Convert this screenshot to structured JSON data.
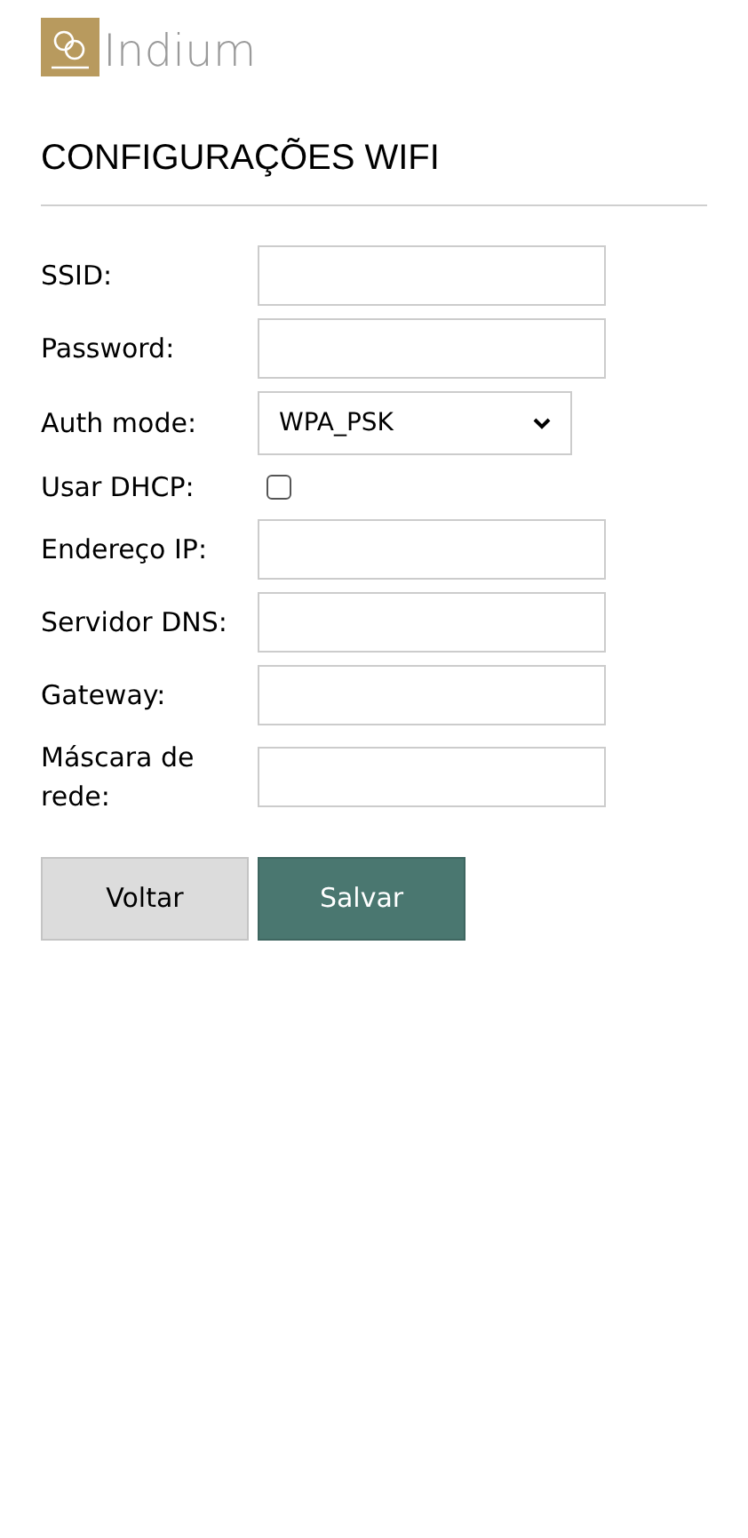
{
  "logo": {
    "text": "Indium"
  },
  "title": "CONFIGURAÇÕES WIFI",
  "fields": [
    {
      "kind": "text",
      "label": "SSID:"
    },
    {
      "kind": "text",
      "label": "Password:"
    },
    {
      "kind": "select",
      "label": "Auth mode:",
      "value": "WPA_PSK"
    },
    {
      "kind": "checkbox",
      "label": "Usar DHCP:",
      "checked": false
    },
    {
      "kind": "text",
      "label": "Endereço IP:"
    },
    {
      "kind": "text",
      "label": "Servidor DNS:"
    },
    {
      "kind": "text",
      "label": "Gateway:"
    },
    {
      "kind": "text",
      "label": "Máscara de rede:"
    }
  ],
  "buttons": [
    {
      "label": "Voltar",
      "kind": "secondary"
    },
    {
      "label": "Salvar",
      "kind": "primary"
    }
  ]
}
